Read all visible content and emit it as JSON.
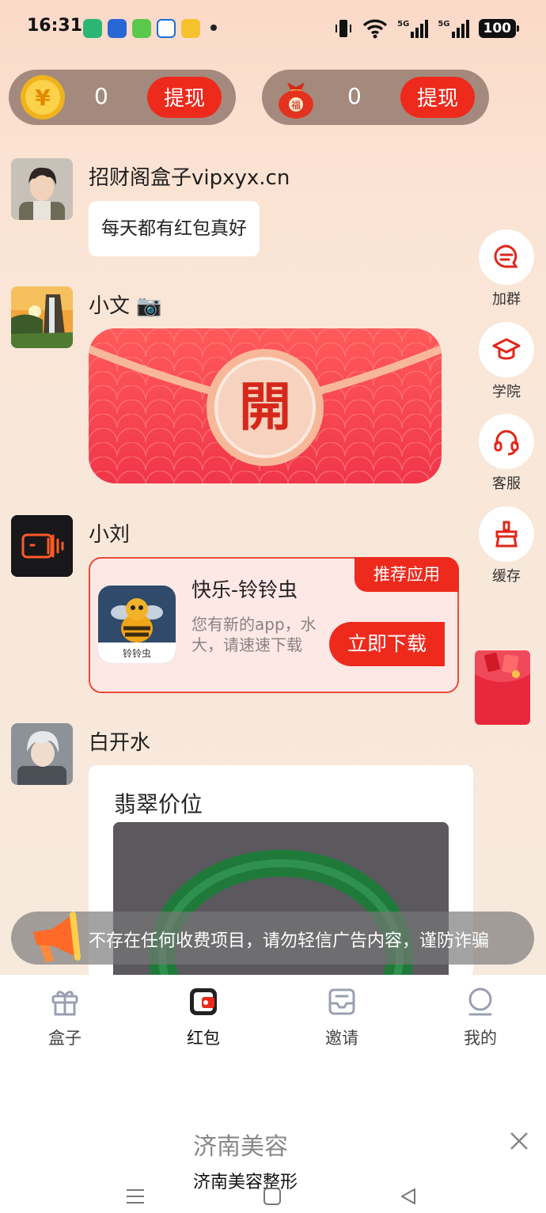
{
  "status_bar": {
    "time": "16:31",
    "network_1": "5G",
    "network_2": "5G",
    "battery": "100"
  },
  "wallet": {
    "coin": {
      "amount": "0",
      "withdraw_label": "提现"
    },
    "lucky_bag": {
      "icon_char": "福",
      "amount": "0",
      "withdraw_label": "提现"
    }
  },
  "messages": [
    {
      "sender": "招财阁盒子vipxyx.cn",
      "text": "每天都有红包真好"
    },
    {
      "sender": "小文 📷",
      "packet_char": "開"
    },
    {
      "sender": "小刘",
      "app_card": {
        "tag": "推荐应用",
        "name": "快乐-铃铃虫",
        "icon_text": "铃铃虫",
        "desc": "您有新的app，水大，请速速下载",
        "download_label": "立即下载"
      }
    },
    {
      "sender": "白开水",
      "article_title": "翡翠价位"
    }
  ],
  "side_actions": [
    {
      "label": "加群",
      "icon": "chat-icon"
    },
    {
      "label": "学院",
      "icon": "graduation-cap-icon"
    },
    {
      "label": "客服",
      "icon": "headset-icon"
    },
    {
      "label": "缓存",
      "icon": "broom-icon"
    }
  ],
  "notice": "不存在任何收费项目，请勿轻信广告内容，谨防诈骗",
  "bottom_nav": [
    {
      "label": "盒子",
      "icon": "gift-icon"
    },
    {
      "label": "红包",
      "icon": "red-packet-icon",
      "active": true
    },
    {
      "label": "邀请",
      "icon": "invite-tray-icon"
    },
    {
      "label": "我的",
      "icon": "profile-icon"
    }
  ],
  "ad": {
    "title": "济南美容",
    "subtitle": "济南美容整形"
  },
  "colors": {
    "accent": "#ee2a1c",
    "background": "#f9e6d8",
    "pill": "#6e564c"
  }
}
